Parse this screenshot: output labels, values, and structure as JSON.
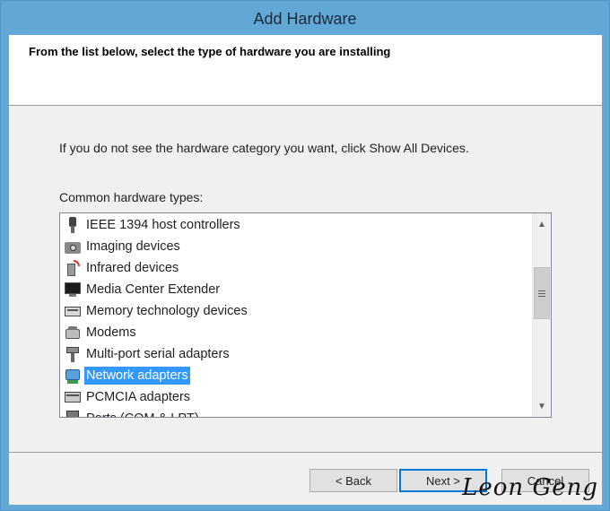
{
  "window": {
    "title": "Add Hardware"
  },
  "header": {
    "instruction": "From the list below, select the type of hardware you are installing"
  },
  "body": {
    "hint": "If you do not see the hardware category you want, click Show All Devices.",
    "list_label": "Common hardware types:"
  },
  "hardware_list": {
    "items": [
      {
        "label": "IEEE 1394 host controllers",
        "icon": "firewire-icon"
      },
      {
        "label": "Imaging devices",
        "icon": "camera-icon"
      },
      {
        "label": "Infrared devices",
        "icon": "infrared-icon"
      },
      {
        "label": "Media Center Extender",
        "icon": "monitor-icon"
      },
      {
        "label": "Memory technology devices",
        "icon": "memory-card-icon"
      },
      {
        "label": "Modems",
        "icon": "modem-icon"
      },
      {
        "label": "Multi-port serial adapters",
        "icon": "serial-port-icon"
      },
      {
        "label": "Network adapters",
        "icon": "network-adapter-icon"
      },
      {
        "label": "PCMCIA adapters",
        "icon": "pcmcia-icon"
      },
      {
        "label": "Ports (COM & LPT)",
        "icon": "port-icon"
      }
    ],
    "selected": "Network adapters"
  },
  "buttons": {
    "back": "< Back",
    "next": "Next >",
    "cancel": "Cancel"
  },
  "watermark": "Leon Geng",
  "colors": {
    "title_bar": "#62a8d6",
    "selection": "#3399ff",
    "default_button_border": "#0078d7"
  }
}
